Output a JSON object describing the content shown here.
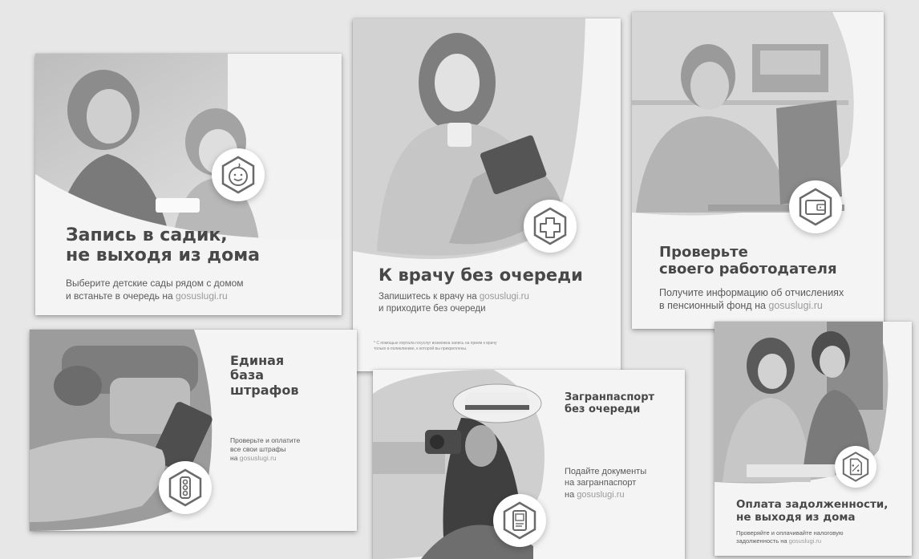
{
  "cards": {
    "kindergarten": {
      "title_line1": "Запись в садик,",
      "title_line2": "не выходя из дома",
      "desc_line1": "Выберите детские сады рядом с домом",
      "desc_line2_prefix": "и встаньте в очередь на ",
      "link": "gosuslugi.ru",
      "icon": "smiley-baby-icon"
    },
    "doctor": {
      "title": "К врачу без очереди",
      "desc_line1_prefix": "Запишитесь к врачу на ",
      "link": "gosuslugi.ru",
      "desc_line2": "и приходите без очереди",
      "note_line1": "* С помощью портала госуслуг возможна запись на прием к врачу",
      "note_line2": "только в поликлинике, к которой вы прикреплены.",
      "icon": "medical-cross-icon"
    },
    "employer": {
      "title_line1": "Проверьте",
      "title_line2": "своего работодателя",
      "desc_line1": "Получите информацию об отчислениях",
      "desc_line2_prefix": "в пенсионный фонд на ",
      "link": "gosuslugi.ru",
      "icon": "wallet-icon"
    },
    "fines": {
      "title_line1": "Единая",
      "title_line2": "база",
      "title_line3": "штрафов",
      "desc_line1": "Проверьте и оплатите",
      "desc_line2": "все свои штрафы",
      "desc_line3_prefix": "на ",
      "link": "gosuslugi.ru",
      "icon": "traffic-light-icon"
    },
    "passport": {
      "title_line1": "Загранпаспорт",
      "title_line2": "без очереди",
      "desc_line1": "Подайте документы",
      "desc_line2": "на загранпаспорт",
      "desc_line3_prefix": "на ",
      "link": "gosuslugi.ru",
      "icon": "passport-icon"
    },
    "debt": {
      "title_line1": "Оплата задолженности,",
      "title_line2": "не выходя из дома",
      "desc_line1": "Проверяйте и оплачивайте налоговую",
      "desc_line2_prefix": "задолженность на ",
      "link": "gosuslugi.ru",
      "icon": "tax-document-icon"
    }
  }
}
